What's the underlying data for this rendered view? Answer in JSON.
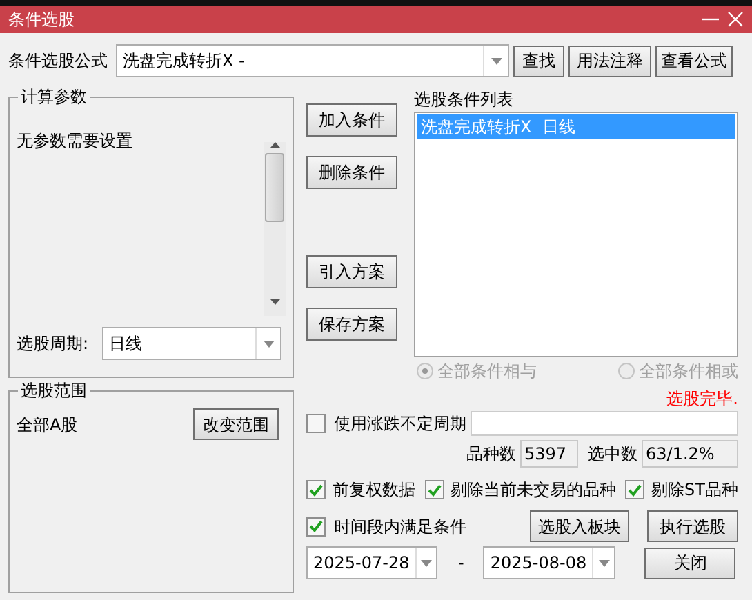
{
  "window": {
    "title": "条件选股"
  },
  "formula": {
    "label": "条件选股公式",
    "value": "洗盘完成转折X -"
  },
  "top_buttons": [
    "查找",
    "用法注释",
    "查看公式"
  ],
  "params": {
    "title": "计算参数",
    "message": "无参数需要设置",
    "period_label": "选股周期:",
    "period_value": "日线"
  },
  "actions": [
    "加入条件",
    "删除条件",
    "引入方案",
    "保存方案"
  ],
  "conditions": {
    "title": "选股条件列表",
    "items": [
      {
        "label": "洗盘完成转折X  日线",
        "selected": true
      }
    ]
  },
  "logic": [
    {
      "label": "全部条件相与",
      "selected": true,
      "disabled": true
    },
    {
      "label": "全部条件相或",
      "selected": false,
      "disabled": true
    }
  ],
  "scope": {
    "title": "选股范围",
    "value": "全部A股",
    "button": "改变范围"
  },
  "status": "选股完毕.",
  "variable_period": {
    "label": "使用涨跌不定周期",
    "checked": false
  },
  "counts": [
    {
      "label": "品种数",
      "value": "5397"
    },
    {
      "label": "选中数",
      "value": "63/1.2%"
    }
  ],
  "options": [
    {
      "label": "前复权数据",
      "checked": true
    },
    {
      "label": "剔除当前未交易的品种",
      "checked": true
    },
    {
      "label": "剔除ST品种",
      "checked": true
    }
  ],
  "time_filter": {
    "label": "时间段内满足条件",
    "checked": true
  },
  "date_from": "2025-07-28",
  "date_separator": "-",
  "date_to": "2025-08-08",
  "bottom_buttons": [
    "选股入板块",
    "执行选股",
    "关闭"
  ]
}
